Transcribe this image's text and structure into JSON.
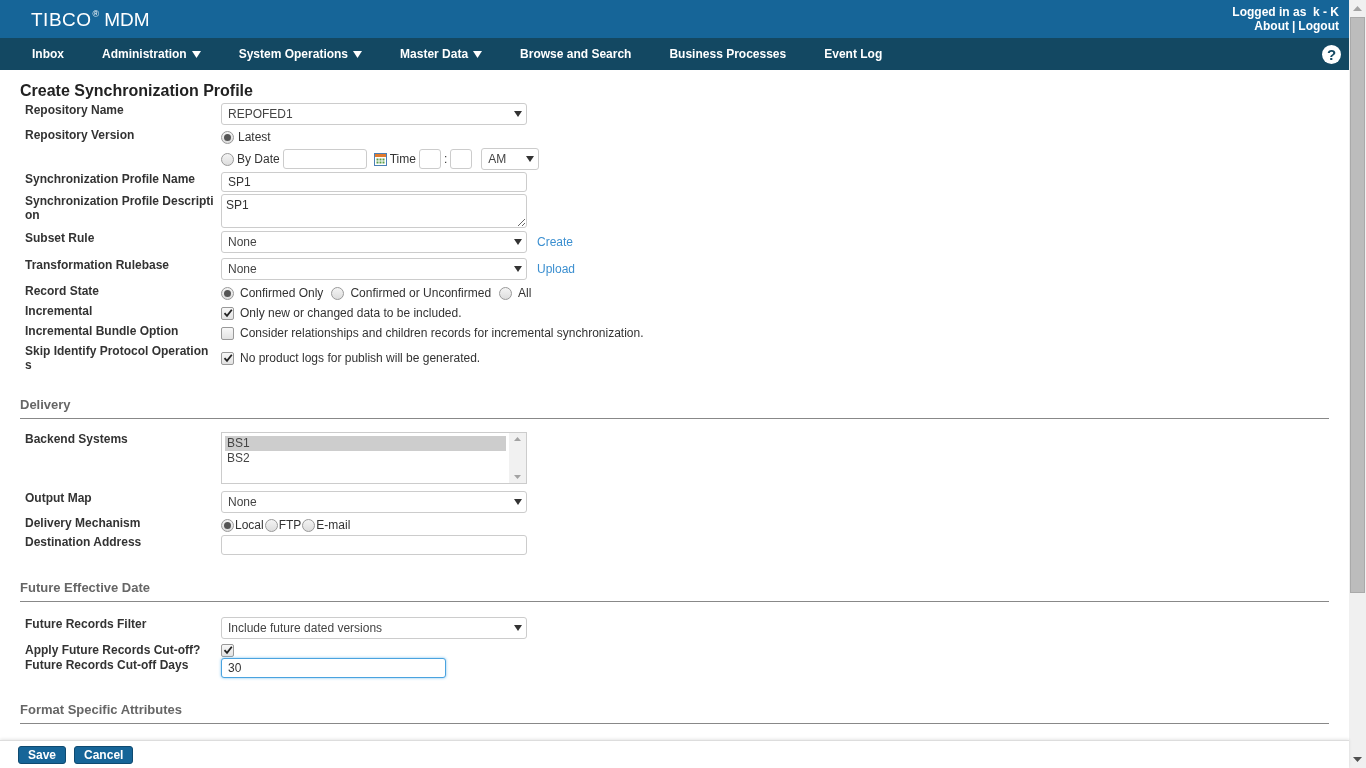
{
  "header": {
    "logo": "TIBCO",
    "logo_mark": "®",
    "product": "MDM",
    "user_line": "Logged in as  k - K",
    "links": [
      "About",
      "Logout"
    ],
    "link_separator": "|"
  },
  "nav": [
    {
      "label": "Inbox",
      "dropdown": false
    },
    {
      "label": "Administration",
      "dropdown": true
    },
    {
      "label": "System Operations",
      "dropdown": true
    },
    {
      "label": "Master Data",
      "dropdown": true
    },
    {
      "label": "Browse and Search",
      "dropdown": false
    },
    {
      "label": "Business Processes",
      "dropdown": false
    },
    {
      "label": "Event Log",
      "dropdown": false
    }
  ],
  "help": "?",
  "page_title": "Create Synchronization Profile",
  "sections": [
    {
      "rows": [
        {
          "kind": "select",
          "label": "Repository Name",
          "value": "REPOFED1"
        },
        {
          "kind": "version",
          "label": "Repository Version",
          "options": [
            {
              "label": "Latest",
              "selected": true
            },
            {
              "label": "By Date",
              "selected": false
            }
          ],
          "time_label": "Time",
          "time_separator": ":",
          "ampm": "AM"
        },
        {
          "kind": "text",
          "label": "Synchronization Profile Name",
          "value": "SP1"
        },
        {
          "kind": "textarea",
          "label": "Synchronization Profile Description",
          "value": "SP1"
        },
        {
          "kind": "select",
          "label": "Subset Rule",
          "value": "None",
          "link": "Create"
        },
        {
          "kind": "select",
          "label": "Transformation Rulebase",
          "value": "None",
          "link": "Upload"
        },
        {
          "kind": "radio",
          "label": "Record State",
          "options": [
            {
              "label": "Confirmed Only",
              "selected": true
            },
            {
              "label": "Confirmed or Unconfirmed",
              "selected": false
            },
            {
              "label": "All",
              "selected": false
            }
          ]
        },
        {
          "kind": "checkbox",
          "label": "Incremental",
          "checked": true,
          "text": "Only new or changed data to be included."
        },
        {
          "kind": "checkbox",
          "label": "Incremental Bundle Option",
          "checked": false,
          "text": "Consider relationships and children records for incremental synchronization."
        },
        {
          "kind": "checkbox",
          "label": "Skip Identify Protocol Operations",
          "checked": true,
          "text": "No product logs for publish will be generated."
        }
      ]
    },
    {
      "title": "Delivery",
      "rows": [
        {
          "kind": "listbox",
          "label": "Backend Systems",
          "items": [
            {
              "label": "BS1",
              "selected": true
            },
            {
              "label": "BS2",
              "selected": false
            }
          ]
        },
        {
          "kind": "select",
          "label": "Output Map",
          "value": "None"
        },
        {
          "kind": "radio-compact",
          "label": "Delivery Mechanism",
          "options": [
            {
              "label": "Local",
              "selected": true
            },
            {
              "label": "FTP",
              "selected": false
            },
            {
              "label": "E-mail",
              "selected": false
            }
          ]
        },
        {
          "kind": "text",
          "label": "Destination Address"
        }
      ]
    },
    {
      "title": "Future Effective Date",
      "rows": [
        {
          "kind": "select",
          "label": "Future Records Filter",
          "value": "Include future dated versions"
        },
        {
          "kind": "checkbox",
          "label": "Apply Future Records Cut-off?",
          "checked": true
        },
        {
          "kind": "number",
          "label": "Future Records Cut-off Days",
          "value": "30",
          "focused": true
        }
      ]
    },
    {
      "title": "Format Specific Attributes"
    }
  ],
  "footer": {
    "buttons": [
      "Save",
      "Cancel"
    ]
  }
}
